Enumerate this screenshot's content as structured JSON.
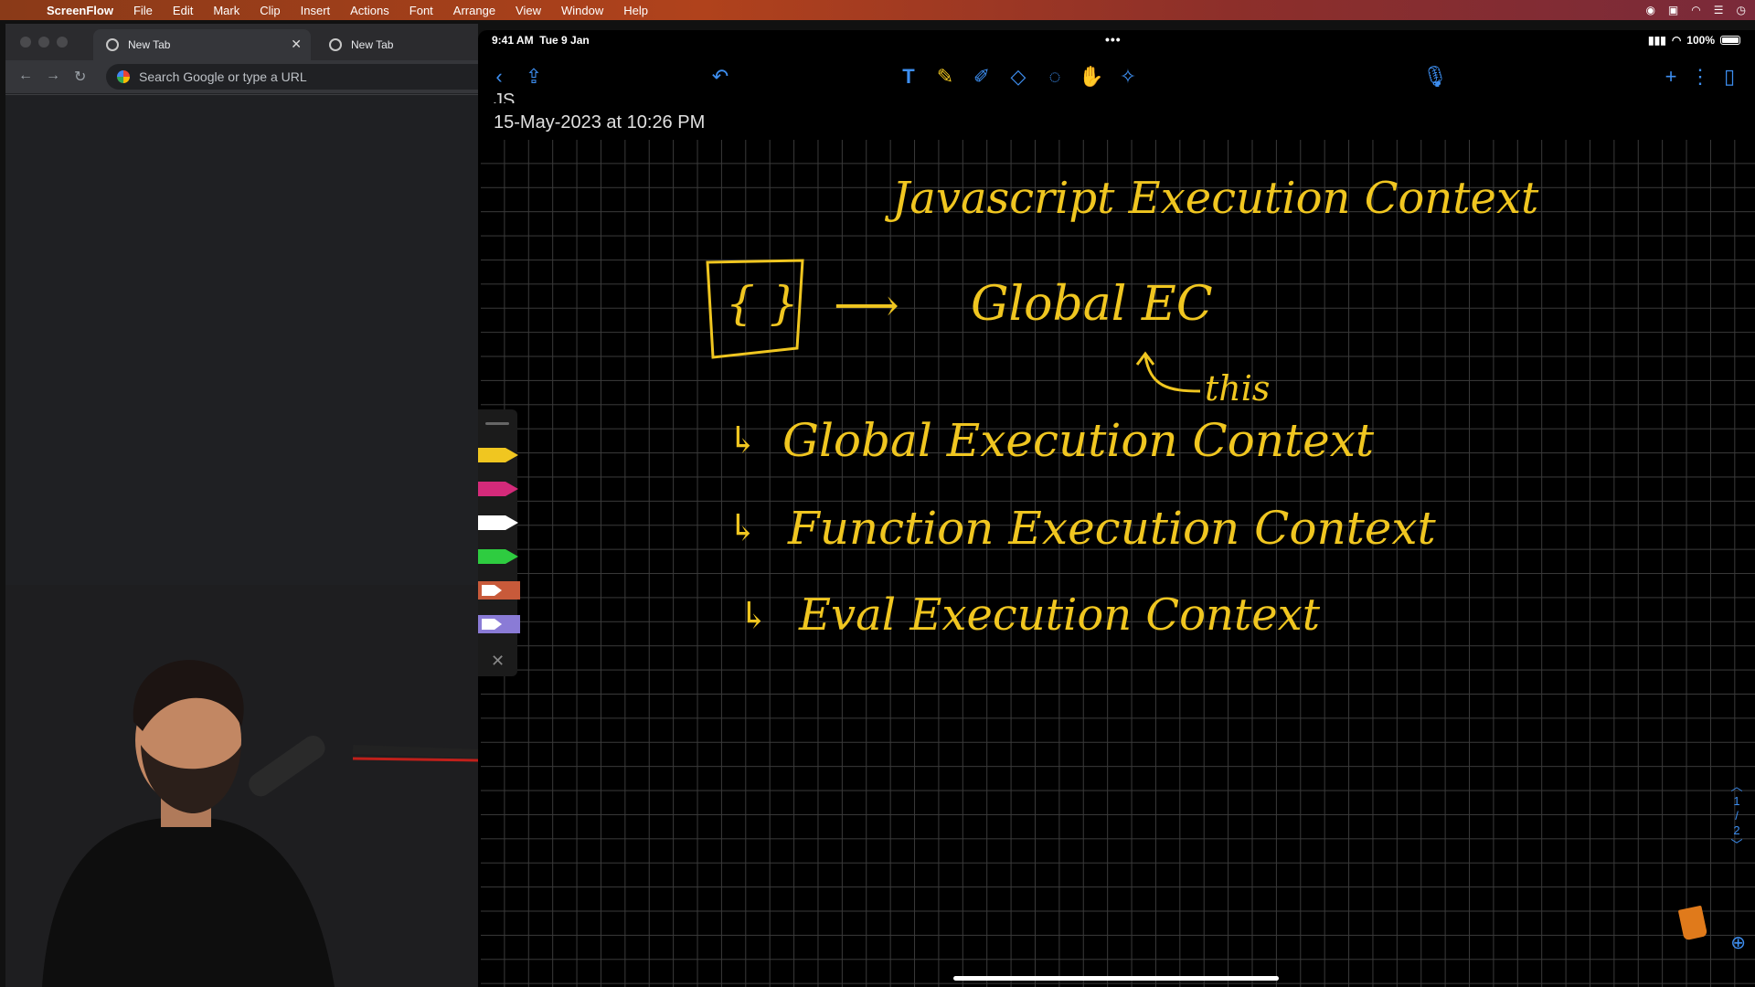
{
  "menubar": {
    "apple_icon": "apple-logo-icon",
    "app_name": "ScreenFlow",
    "items": [
      "File",
      "Edit",
      "Mark",
      "Clip",
      "Insert",
      "Actions",
      "Font",
      "Arrange",
      "View",
      "Window",
      "Help"
    ]
  },
  "browser": {
    "tabs": [
      {
        "label": "New Tab",
        "active": true
      },
      {
        "label": "New Tab",
        "active": false
      }
    ],
    "omnibox_placeholder": "Search Google or type a URL"
  },
  "ipad": {
    "status": {
      "time": "9:41 AM",
      "date": "Tue 9 Jan",
      "dots": "•••",
      "battery": "100%"
    },
    "doc_title": "JS",
    "doc_date": "15-May-2023 at 10:26 PM",
    "pager": {
      "current": "1",
      "separator": "/",
      "total": "2"
    }
  },
  "notes": {
    "heading": "Javascript Execution Context",
    "box_label": "{ }",
    "arrow": "⟶",
    "global_ec": "Global EC",
    "this_label": "this",
    "items": [
      "Global Execution Context",
      "Function Execution Context",
      "Eval Execution Context"
    ],
    "item_prefix": "↳",
    "ink_color": "#f0c620"
  },
  "pen_colors": [
    "#f0c620",
    "#d42a7a",
    "#ffffff",
    "#2ecc40",
    "#c85a3a",
    "#8a7bd6"
  ]
}
